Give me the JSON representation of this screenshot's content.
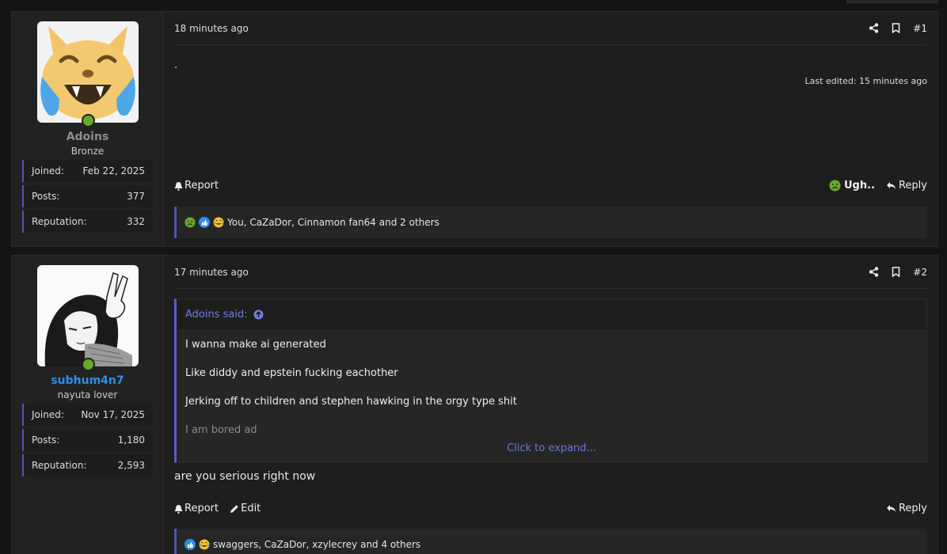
{
  "posts": [
    {
      "username": "Adoins",
      "user_title": "Bronze",
      "stats": [
        {
          "label": "Joined:",
          "value": "Feb 22, 2025"
        },
        {
          "label": "Posts:",
          "value": "377"
        },
        {
          "label": "Reputation:",
          "value": "332"
        }
      ],
      "time": "18 minutes ago",
      "number": "#1",
      "body_text": ".",
      "last_edited": "Last edited: 15 minutes ago",
      "report_label": "Report",
      "reaction_label": "Ugh..",
      "reply_label": "Reply",
      "reactions_text": "You, CaZaDor, Cinnamon fan64 and 2 others"
    },
    {
      "username": "subhum4n7",
      "user_title": "nayuta lover",
      "stats": [
        {
          "label": "Joined:",
          "value": "Nov 17, 2025"
        },
        {
          "label": "Posts:",
          "value": "1,180"
        },
        {
          "label": "Reputation:",
          "value": "2,593"
        }
      ],
      "time": "17 minutes ago",
      "number": "#2",
      "quote_author": "Adoins said:",
      "quote_lines": [
        "I wanna make ai generated",
        "Like diddy and epstein fucking eachother",
        "Jerking off to children and stephen hawking in the orgy type shit",
        "I am bored ad"
      ],
      "expand_label": "Click to expand...",
      "body_text": "are you serious right now",
      "report_label": "Report",
      "edit_label": "Edit",
      "reply_label": "Reply",
      "reactions_text": "swaggers, CaZaDor, xzylecrey and 4 others"
    }
  ]
}
